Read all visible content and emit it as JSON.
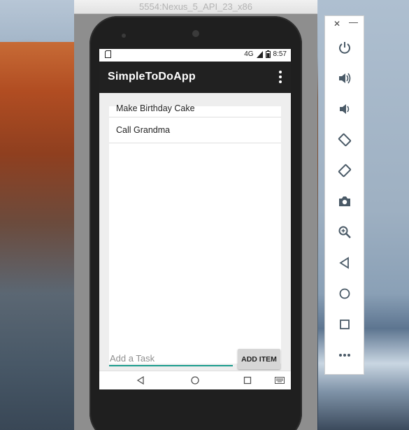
{
  "emulator": {
    "window_title": "5554:Nexus_5_API_23_x86"
  },
  "status_bar": {
    "time": "8:57",
    "signal": "4G"
  },
  "app": {
    "title": "SimpleToDoApp"
  },
  "tasks": [
    {
      "label": "Make Birthday Cake"
    },
    {
      "label": "Call Grandma"
    }
  ],
  "input": {
    "placeholder": "Add a Task",
    "value": ""
  },
  "add_button": {
    "label": "ADD ITEM"
  },
  "toolbar": {
    "close_label": "✕",
    "minimize_label": "—",
    "icons": [
      "power-icon",
      "volume-up-icon",
      "volume-down-icon",
      "rotate-left-icon",
      "rotate-right-icon",
      "camera-icon",
      "zoom-icon",
      "back-icon",
      "home-icon",
      "overview-icon",
      "more-icon"
    ]
  },
  "colors": {
    "app_bar": "#212121",
    "accent": "#1a9c8c",
    "toolbar_icon": "#4a5a67"
  }
}
